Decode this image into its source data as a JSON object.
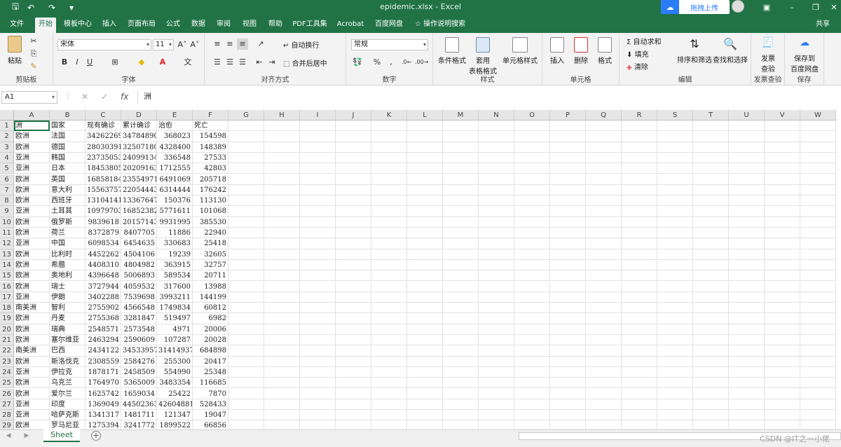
{
  "window": {
    "title": "epidemic.xlsx  -  Excel",
    "upload_label": "拖拽上传"
  },
  "tabs": [
    "文件",
    "开始",
    "模板中心",
    "插入",
    "页面布局",
    "公式",
    "数据",
    "审阅",
    "视图",
    "帮助",
    "PDF工具集",
    "Acrobat",
    "百度网盘"
  ],
  "active_tab": "开始",
  "tell_me": "操作说明搜索",
  "share": "共享",
  "ribbon": {
    "clipboard": {
      "label": "剪贴板",
      "paste": "粘贴"
    },
    "font": {
      "label": "字体",
      "name": "宋体",
      "size": "11",
      "bold": "B",
      "italic": "I",
      "underline": "U"
    },
    "alignment": {
      "label": "对齐方式",
      "wrap": "自动换行",
      "merge": "合并后居中"
    },
    "number": {
      "label": "数字",
      "format": "常规"
    },
    "styles": {
      "label": "样式",
      "conditional": "条件格式",
      "table1": "套用",
      "table2": "表格格式",
      "cell_styles": "单元格样式"
    },
    "cells": {
      "label": "单元格",
      "insert": "插入",
      "delete": "删除",
      "format": "格式"
    },
    "editing": {
      "label": "编辑",
      "autosum": "自动求和",
      "fill": "填充",
      "clear": "清除",
      "sort": "排序和筛选",
      "find": "查找和选择"
    },
    "invoice": {
      "label": "发票查验",
      "btn1": "发票",
      "btn2": "查验"
    },
    "save": {
      "label": "保存",
      "btn1": "保存到",
      "btn2": "百度网盘"
    }
  },
  "formula_bar": {
    "name_box": "A1",
    "content": "洲"
  },
  "columns": [
    "A",
    "B",
    "C",
    "D",
    "E",
    "F",
    "G",
    "H",
    "I",
    "J",
    "K",
    "L",
    "M",
    "N",
    "O",
    "P",
    "Q",
    "R",
    "S",
    "T",
    "U",
    "V",
    "W"
  ],
  "rows": [
    [
      "洲",
      "国家",
      "现有确诊",
      "累计确诊",
      "治愈",
      "死亡"
    ],
    [
      "欧洲",
      "法国",
      "34262269",
      "34784890",
      "368023",
      "154598"
    ],
    [
      "欧洲",
      "德国",
      "28030391",
      "32507180",
      "4328400",
      "148389"
    ],
    [
      "亚洲",
      "韩国",
      "23735053",
      "24099134",
      "336548",
      "27533"
    ],
    [
      "亚洲",
      "日本",
      "18453805",
      "20209163",
      "1712555",
      "42803"
    ],
    [
      "欧洲",
      "英国",
      "16858184",
      "23554971",
      "6491069",
      "205718"
    ],
    [
      "欧洲",
      "意大利",
      "15563757",
      "22054443",
      "6314444",
      "176242"
    ],
    [
      "欧洲",
      "西班牙",
      "13104141",
      "13367647",
      "150376",
      "113130"
    ],
    [
      "亚洲",
      "土耳其",
      "10979703",
      "16852382",
      "5771611",
      "101068"
    ],
    [
      "欧洲",
      "俄罗斯",
      "9839618",
      "20157143",
      "9931995",
      "385530"
    ],
    [
      "欧洲",
      "荷兰",
      "8372879",
      "8407705",
      "11886",
      "22940"
    ],
    [
      "亚洲",
      "中国",
      "6098534",
      "6454635",
      "330683",
      "25418"
    ],
    [
      "欧洲",
      "比利时",
      "4452262",
      "4504106",
      "19239",
      "32605"
    ],
    [
      "欧洲",
      "希腊",
      "4408310",
      "4804982",
      "363915",
      "32757"
    ],
    [
      "欧洲",
      "奥地利",
      "4396648",
      "5006893",
      "589534",
      "20711"
    ],
    [
      "欧洲",
      "瑞士",
      "3727944",
      "4059532",
      "317600",
      "13988"
    ],
    [
      "亚洲",
      "伊朗",
      "3402288",
      "7539698",
      "3993211",
      "144199"
    ],
    [
      "南美洲",
      "智利",
      "2755902",
      "4566548",
      "1749834",
      "60812"
    ],
    [
      "欧洲",
      "丹麦",
      "2755368",
      "3281847",
      "519497",
      "6982"
    ],
    [
      "欧洲",
      "瑞典",
      "2548571",
      "2573548",
      "4971",
      "20006"
    ],
    [
      "欧洲",
      "塞尔维亚",
      "2463294",
      "2590609",
      "107287",
      "20028"
    ],
    [
      "南美洲",
      "巴西",
      "2434122",
      "34533957",
      "31414937",
      "684898"
    ],
    [
      "欧洲",
      "斯洛伐克",
      "2308559",
      "2584276",
      "255300",
      "20417"
    ],
    [
      "亚洲",
      "伊拉克",
      "1878171",
      "2458509",
      "554990",
      "25348"
    ],
    [
      "欧洲",
      "乌克兰",
      "1764970",
      "5365009",
      "3483354",
      "116685"
    ],
    [
      "欧洲",
      "爱尔兰",
      "1625742",
      "1659034",
      "25422",
      "7870"
    ],
    [
      "亚洲",
      "印度",
      "1369049",
      "44502363",
      "42604881",
      "528433"
    ],
    [
      "亚洲",
      "哈萨克斯",
      "1341317",
      "1481711",
      "121347",
      "19047"
    ],
    [
      "欧洲",
      "罗马尼亚",
      "1275394",
      "3241772",
      "1899522",
      "66856"
    ]
  ],
  "sheet_tab": "Sheet",
  "watermark": "CSDN @IT之一小佬"
}
